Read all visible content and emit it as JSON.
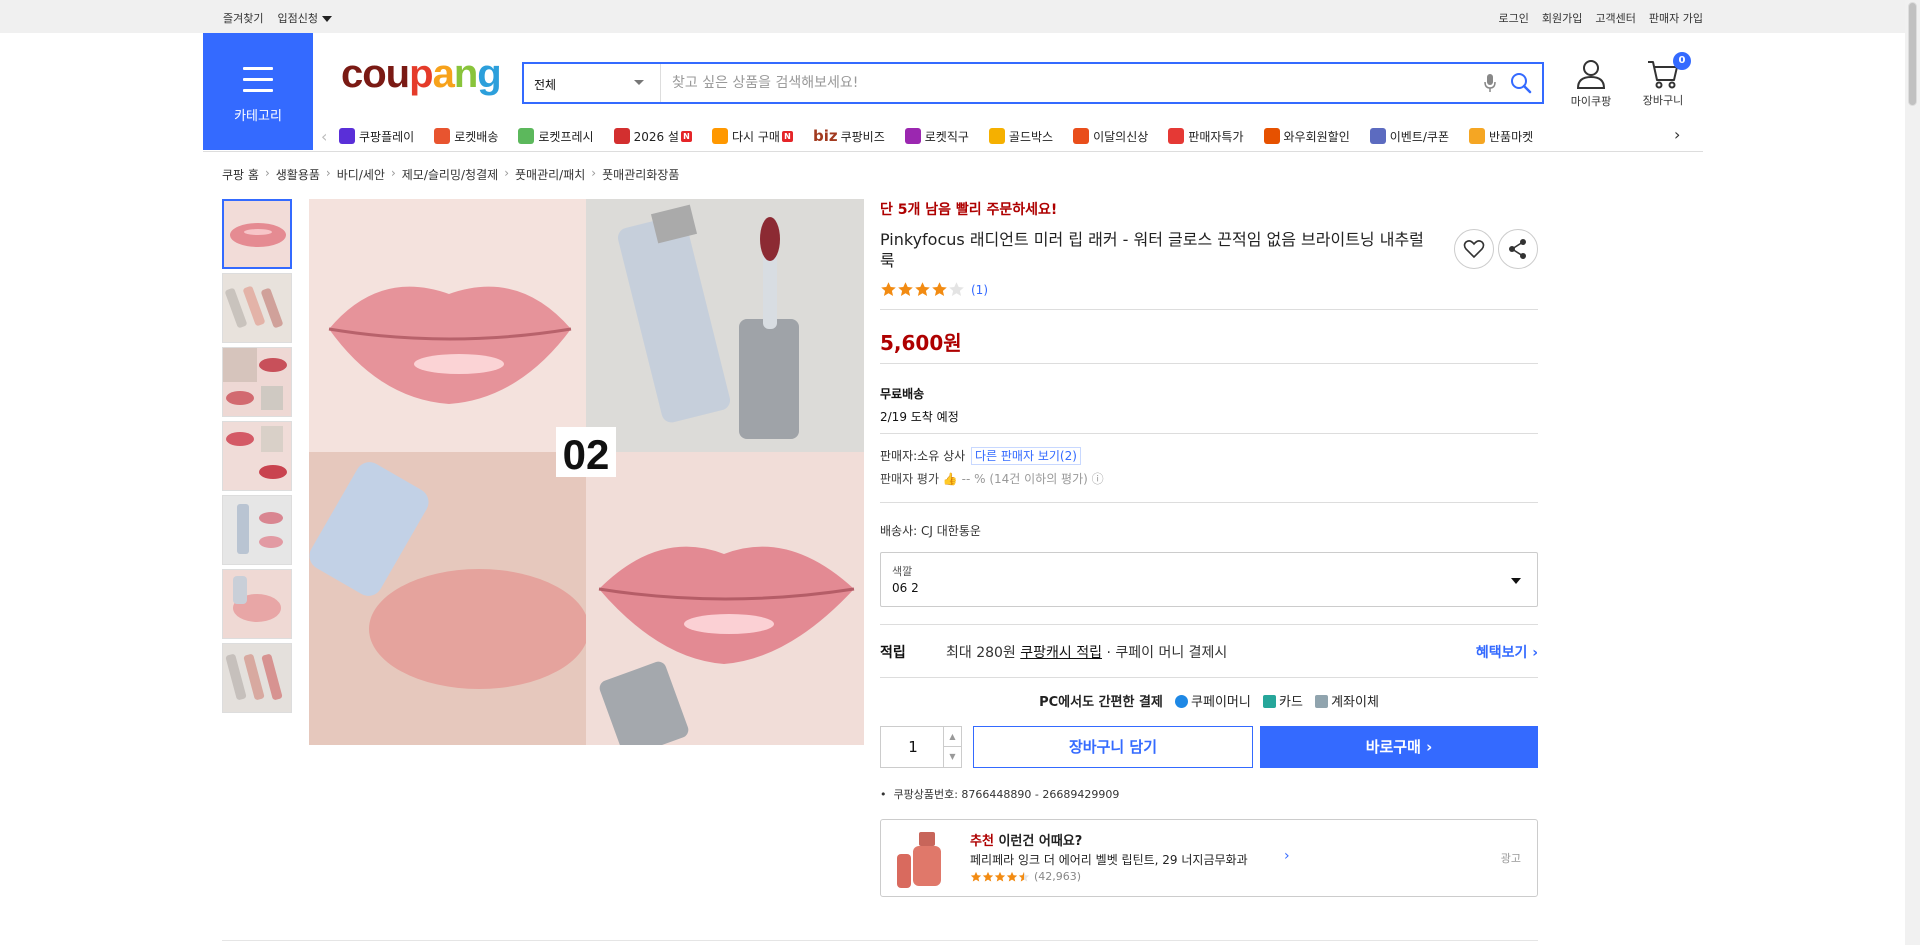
{
  "topbar": {
    "favorites": "즐겨찾기",
    "partner": "입점신청",
    "login": "로그인",
    "signup": "회원가입",
    "support": "고객센터",
    "seller_signup": "판매자 가입"
  },
  "header": {
    "category_label": "카테고리",
    "logo": [
      "cou",
      "p",
      "a",
      "n",
      "g"
    ],
    "search_select": "전체",
    "search_placeholder": "찾고 싶은 상품을 검색해보세요!",
    "mypage": "마이쿠팡",
    "cart": "장바구니",
    "cart_count": "0"
  },
  "shortcuts": [
    {
      "label": "쿠팡플레이",
      "icon": "play-icon",
      "color": "#5a2fd8"
    },
    {
      "label": "로켓배송",
      "icon": "rocket-icon",
      "color": "#e8542f"
    },
    {
      "label": "로켓프레시",
      "icon": "rocket-fresh-icon",
      "color": "#5cb85c"
    },
    {
      "label": "2026 설",
      "icon": "gift-icon",
      "color": "#d32f2f",
      "new": "N"
    },
    {
      "label": "다시 구매",
      "icon": "home-icon",
      "color": "#ff9800",
      "new": "N"
    },
    {
      "label": "쿠팡비즈",
      "icon": "biz-icon",
      "color": "#a23a1f",
      "biz": "biz"
    },
    {
      "label": "로켓직구",
      "icon": "global-icon",
      "color": "#9b27b0"
    },
    {
      "label": "골드박스",
      "icon": "goldbox-icon",
      "color": "#f5b000"
    },
    {
      "label": "이달의신상",
      "icon": "new-bag-icon",
      "color": "#e94e1b"
    },
    {
      "label": "판매자특가",
      "icon": "discount-icon",
      "color": "#e53935"
    },
    {
      "label": "와우회원할인",
      "icon": "wow-icon",
      "color": "#e65100"
    },
    {
      "label": "이벤트/쿠폰",
      "icon": "coupon-icon",
      "color": "#5c6bc0"
    },
    {
      "label": "반품마켓",
      "icon": "return-market-icon",
      "color": "#f5a623"
    }
  ],
  "breadcrumb": [
    "쿠팡 홈",
    "생활용품",
    "바디/세안",
    "제모/슬리밍/청결제",
    "풋매관리/패치",
    "풋매관리화장품"
  ],
  "product": {
    "urgency": "단 5개 남음 빨리 주문하세요!",
    "title": "Pinkyfocus 래디언트 미러 립 래커 - 워터 글로스 끈적임 없음 브라이트닝 내추럴 룩",
    "rating": 4,
    "review_count": "(1)",
    "price": "5,600원",
    "shipping_title": "무료배송",
    "shipping_eta": "2/19 도착 예정",
    "seller_label": "판매자:",
    "seller_name": "소유 상사",
    "other_sellers": "다른 판매자 보기(2)",
    "seller_rating_label": "판매자 평가",
    "seller_rating_value": "-- % (14건 이하의 평가)",
    "courier_label": "배송사:",
    "courier_name": "CJ 대한통운",
    "option_key": "색깔",
    "option_value": "06 2",
    "reward_label": "적립",
    "reward_text_pre": "최대 280원",
    "reward_link": "쿠팡캐시 적립",
    "reward_text_post": "· 쿠페이 머니 결제시",
    "reward_more": "혜택보기",
    "pay_title": "PC에서도 간편한 결제",
    "pay_methods": [
      "쿠페이머니",
      "카드",
      "계좌이체"
    ],
    "quantity": "1",
    "add_to_cart": "장바구니 담기",
    "buy_now": "바로구매",
    "product_id_label": "쿠팡상품번호:",
    "product_id": "8766448890 - 26689429909",
    "main_image_label": "02"
  },
  "recommend": {
    "title_red": "추천",
    "title": "이런건 어때요?",
    "name": "페리페라 잉크 더 에어리 벨벳 립틴트, 29 너지금무화과",
    "rating": 4.5,
    "count": "(42,963)",
    "ad": "광고"
  },
  "colors": {
    "accent": "#346aff",
    "price": "#ae0000"
  }
}
